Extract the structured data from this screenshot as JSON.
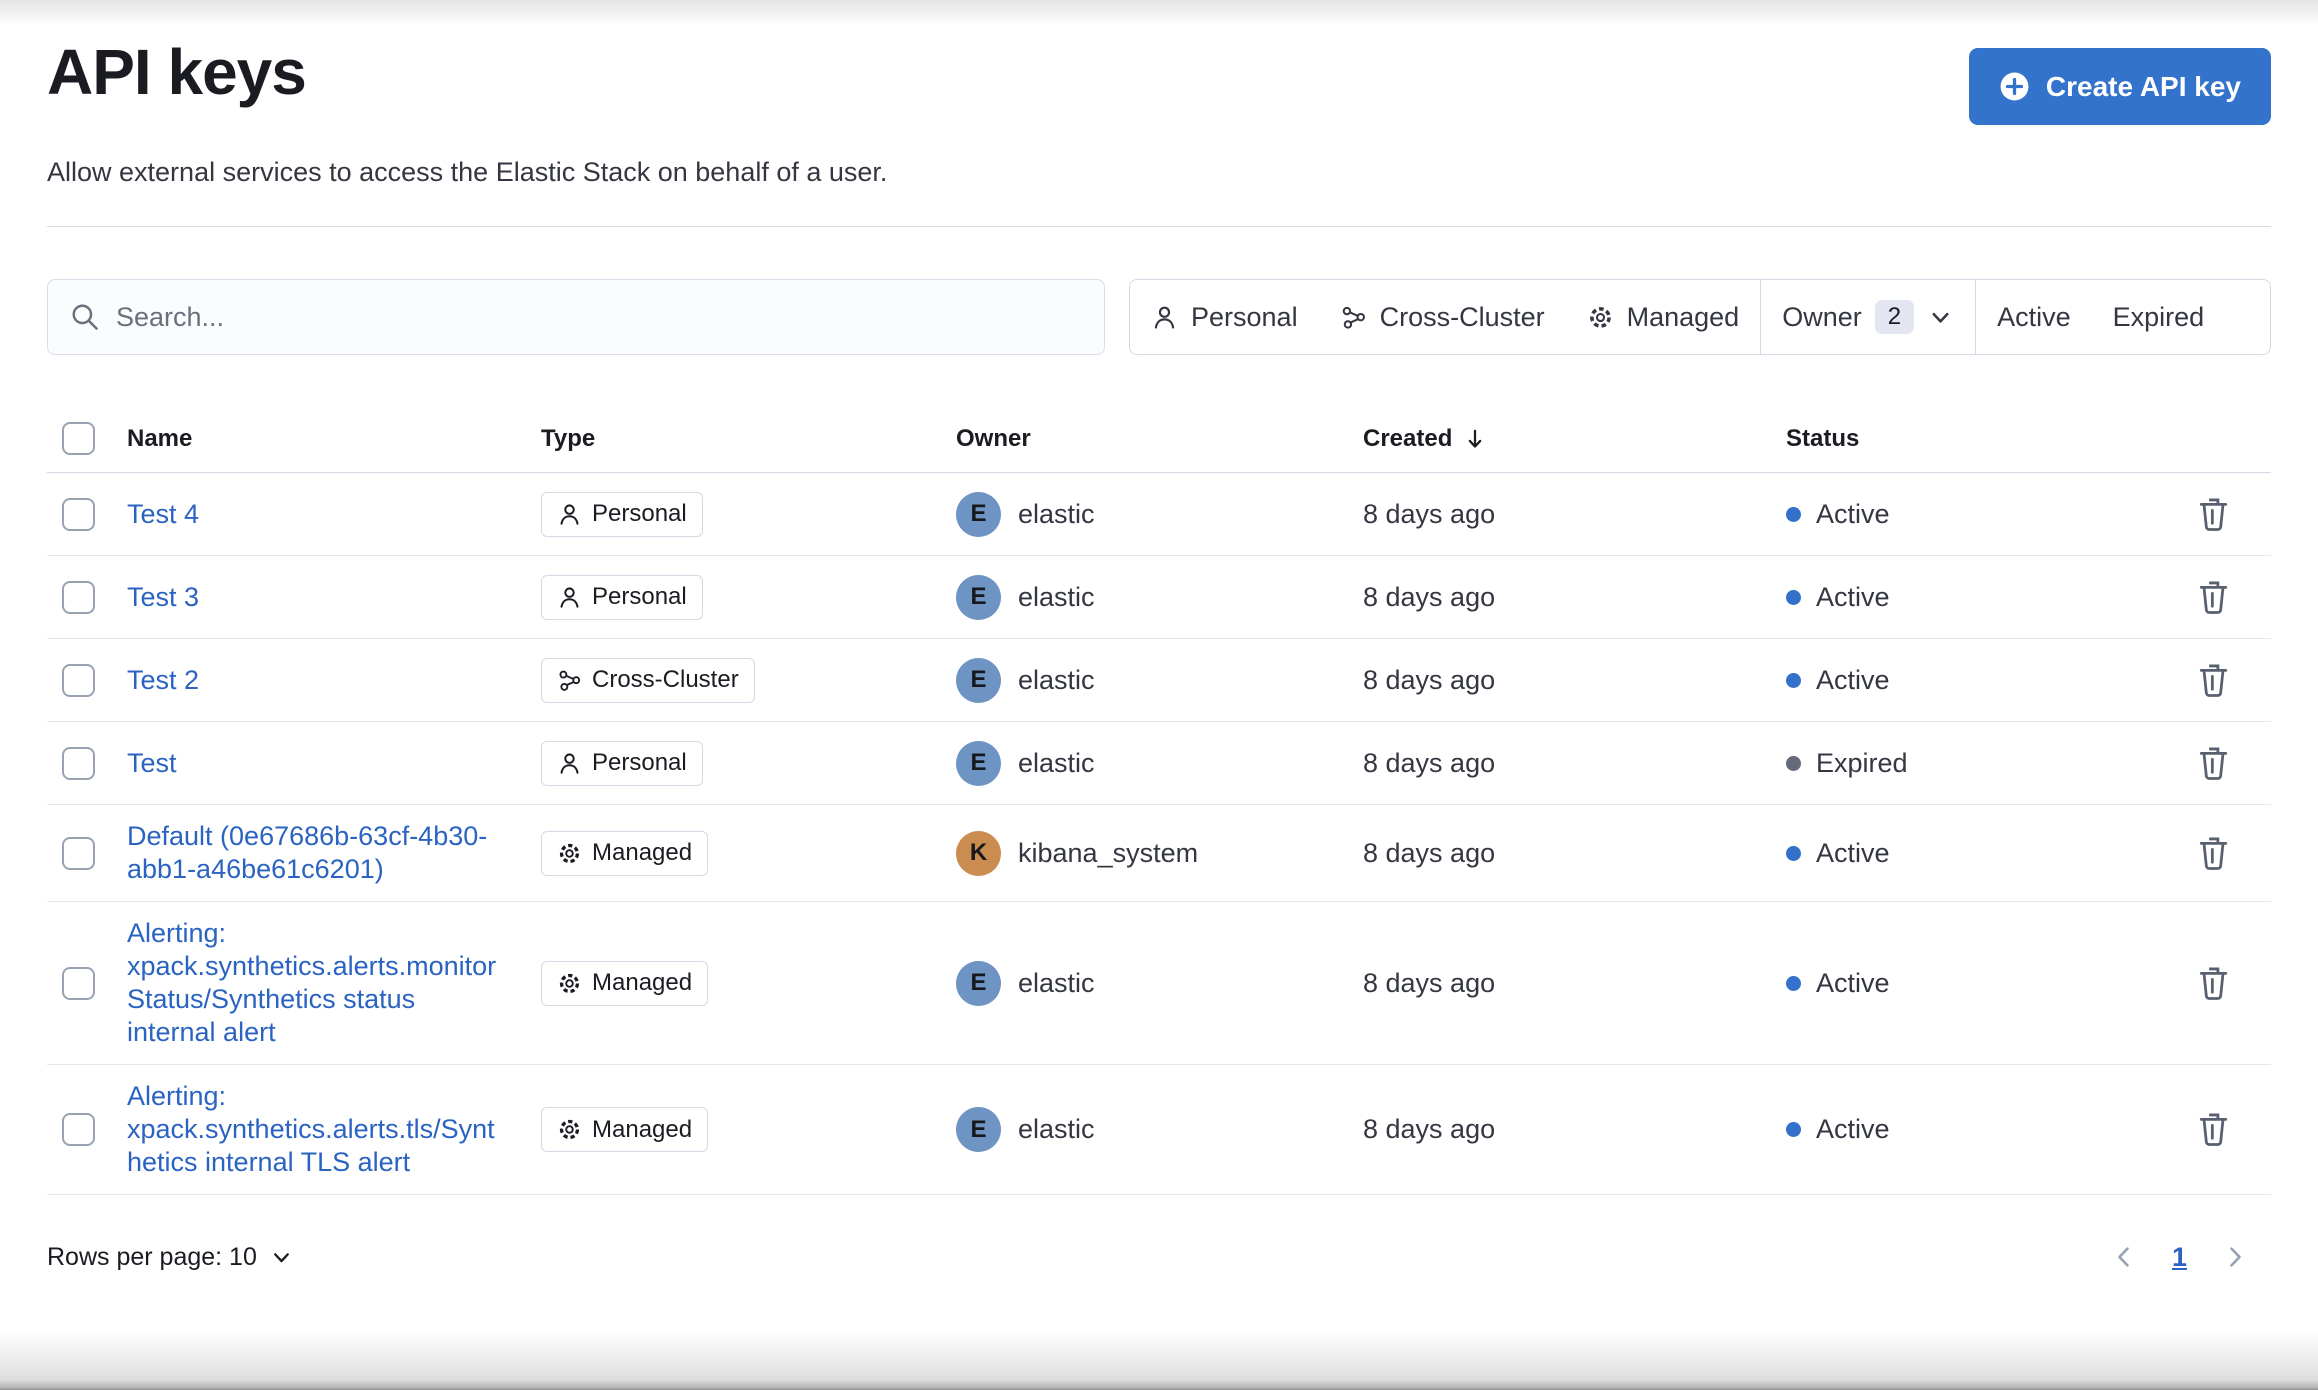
{
  "page": {
    "title": "API keys",
    "subtitle": "Allow external services to access the Elastic Stack on behalf of a user."
  },
  "toolbar": {
    "create_button": "Create API key"
  },
  "search": {
    "placeholder": "Search..."
  },
  "filters": {
    "personal": "Personal",
    "cross_cluster": "Cross-Cluster",
    "managed": "Managed",
    "owner": "Owner",
    "owner_count": "2",
    "active": "Active",
    "expired": "Expired"
  },
  "table": {
    "headers": {
      "name": "Name",
      "type": "Type",
      "owner": "Owner",
      "created": "Created",
      "status": "Status"
    },
    "rows": [
      {
        "name": "Test 4",
        "type": "Personal",
        "type_icon": "person",
        "owner": "elastic",
        "avatar_letter": "E",
        "avatar_color": "#6E94C3",
        "created": "8 days ago",
        "status": "Active"
      },
      {
        "name": "Test 3",
        "type": "Personal",
        "type_icon": "person",
        "owner": "elastic",
        "avatar_letter": "E",
        "avatar_color": "#6E94C3",
        "created": "8 days ago",
        "status": "Active"
      },
      {
        "name": "Test 2",
        "type": "Cross-Cluster",
        "type_icon": "cluster",
        "owner": "elastic",
        "avatar_letter": "E",
        "avatar_color": "#6E94C3",
        "created": "8 days ago",
        "status": "Active"
      },
      {
        "name": "Test",
        "type": "Personal",
        "type_icon": "person",
        "owner": "elastic",
        "avatar_letter": "E",
        "avatar_color": "#6E94C3",
        "created": "8 days ago",
        "status": "Expired"
      },
      {
        "name": "Default (0e67686b-63cf-4b30-abb1-a46be61c6201)",
        "type": "Managed",
        "type_icon": "gear",
        "owner": "kibana_system",
        "avatar_letter": "K",
        "avatar_color": "#CB8C50",
        "created": "8 days ago",
        "status": "Active"
      },
      {
        "name": "Alerting: xpack.synthetics.alerts.monitorStatus/Synthetics status internal alert",
        "type": "Managed",
        "type_icon": "gear",
        "owner": "elastic",
        "avatar_letter": "E",
        "avatar_color": "#6E94C3",
        "created": "8 days ago",
        "status": "Active"
      },
      {
        "name": "Alerting: xpack.synthetics.alerts.tls/Synthetics internal TLS alert",
        "type": "Managed",
        "type_icon": "gear",
        "owner": "elastic",
        "avatar_letter": "E",
        "avatar_color": "#6E94C3",
        "created": "8 days ago",
        "status": "Active"
      }
    ]
  },
  "pagination": {
    "rows_per_page_label": "Rows per page: 10",
    "current_page": "1"
  },
  "colors": {
    "accent": "#3373CB",
    "link": "#2A63C2",
    "active_dot": "#3371CA",
    "expired_dot": "#646A77",
    "avatar_elastic": "#6E94C3",
    "avatar_kibana_system": "#CB8C50"
  }
}
